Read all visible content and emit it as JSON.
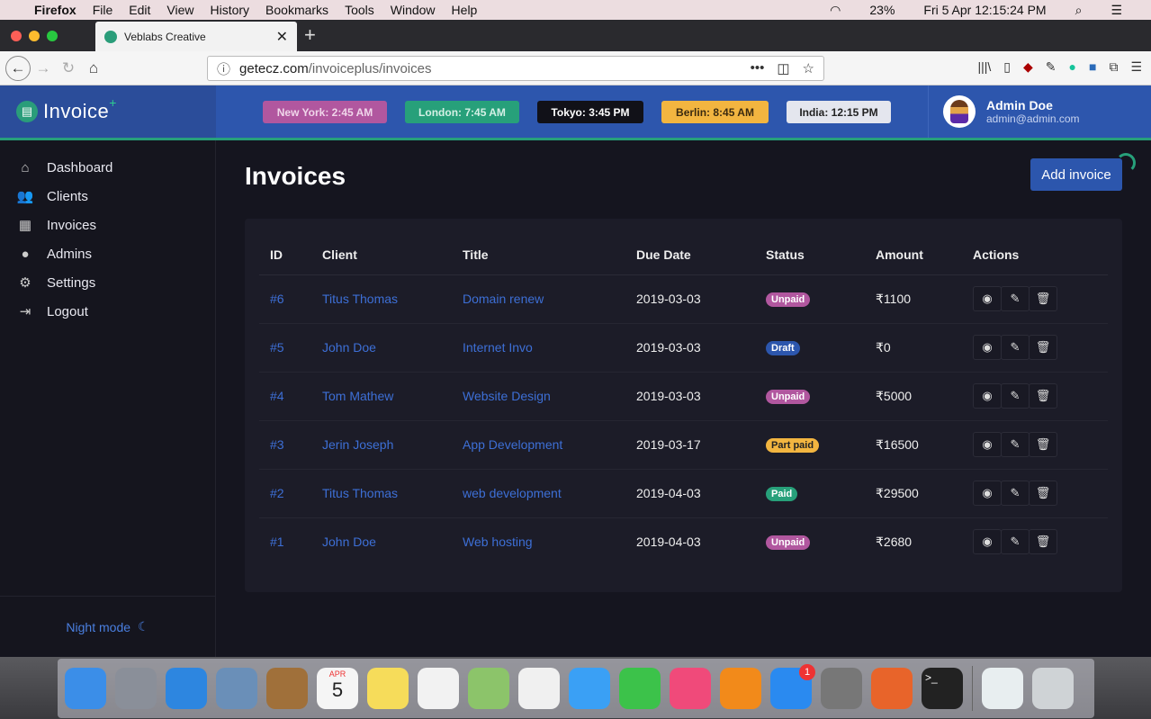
{
  "menubar": {
    "app": "Firefox",
    "items": [
      "File",
      "Edit",
      "View",
      "History",
      "Bookmarks",
      "Tools",
      "Window",
      "Help"
    ],
    "battery": "23%",
    "datetime": "Fri 5 Apr  12:15:24 PM"
  },
  "browser": {
    "tab_title": "Veblabs Creative",
    "url_host": "getecz.com",
    "url_path": "/invoiceplus/invoices"
  },
  "app": {
    "logo": "Invoice",
    "logo_plus": "+",
    "clocks": [
      {
        "label": "New York: 2:45 AM",
        "bg": "#b1579f",
        "fg": "#f0d6ea"
      },
      {
        "label": "London: 7:45 AM",
        "bg": "#27a07a",
        "fg": "#d5f0e6"
      },
      {
        "label": "Tokyo: 3:45 PM",
        "bg": "#111118",
        "fg": "#ffffff"
      },
      {
        "label": "Berlin: 8:45 AM",
        "bg": "#f2b540",
        "fg": "#3a2a10"
      },
      {
        "label": "India: 12:15 PM",
        "bg": "#e4e6ee",
        "fg": "#222"
      }
    ],
    "user": {
      "name": "Admin Doe",
      "email": "admin@admin.com"
    }
  },
  "sidebar": {
    "items": [
      {
        "label": "Dashboard",
        "icon": "⌂"
      },
      {
        "label": "Clients",
        "icon": "👥"
      },
      {
        "label": "Invoices",
        "icon": "▦"
      },
      {
        "label": "Admins",
        "icon": "●"
      },
      {
        "label": "Settings",
        "icon": "⚙"
      },
      {
        "label": "Logout",
        "icon": "⇥"
      }
    ],
    "night_mode": "Night mode",
    "night_icon": "☾"
  },
  "main": {
    "title": "Invoices",
    "add_button": "Add invoice",
    "columns": [
      "ID",
      "Client",
      "Title",
      "Due Date",
      "Status",
      "Amount",
      "Actions"
    ],
    "rows": [
      {
        "id": "#6",
        "client": "Titus Thomas",
        "title": "Domain renew",
        "due": "2019-03-03",
        "status": "Unpaid",
        "amount": "₹1100"
      },
      {
        "id": "#5",
        "client": "John Doe",
        "title": "Internet Invo",
        "due": "2019-03-03",
        "status": "Draft",
        "amount": "₹0"
      },
      {
        "id": "#4",
        "client": "Tom Mathew",
        "title": "Website Design",
        "due": "2019-03-03",
        "status": "Unpaid",
        "amount": "₹5000"
      },
      {
        "id": "#3",
        "client": "Jerin Joseph",
        "title": "App Development",
        "due": "2019-03-17",
        "status": "Part paid",
        "amount": "₹16500"
      },
      {
        "id": "#2",
        "client": "Titus Thomas",
        "title": "web development",
        "due": "2019-04-03",
        "status": "Paid",
        "amount": "₹29500"
      },
      {
        "id": "#1",
        "client": "John Doe",
        "title": "Web hosting",
        "due": "2019-04-03",
        "status": "Unpaid",
        "amount": "₹2680"
      }
    ],
    "status_colors": {
      "Unpaid": "#b1579f",
      "Draft": "#2c56ad",
      "Part paid": "#f2b540",
      "Paid": "#27a07a"
    }
  },
  "dock": {
    "calendar_month": "APR",
    "calendar_day": "5",
    "appstore_badge": "1",
    "apps": [
      {
        "name": "finder",
        "color": "#3b8ee8"
      },
      {
        "name": "launchpad",
        "color": "#8a8f99"
      },
      {
        "name": "safari",
        "color": "#2d86e0"
      },
      {
        "name": "preview",
        "color": "#6a8fb8"
      },
      {
        "name": "contacts",
        "color": "#a0703a"
      },
      {
        "name": "calendar",
        "color": "#f5f5f5"
      },
      {
        "name": "notes",
        "color": "#f6dc5a"
      },
      {
        "name": "reminders",
        "color": "#f2f2f2"
      },
      {
        "name": "maps",
        "color": "#8cc46a"
      },
      {
        "name": "photos",
        "color": "#f0f0f0"
      },
      {
        "name": "messages",
        "color": "#3aa0f5"
      },
      {
        "name": "facetime",
        "color": "#3cc24a"
      },
      {
        "name": "itunes",
        "color": "#f04a7a"
      },
      {
        "name": "books",
        "color": "#f28a1a"
      },
      {
        "name": "app-store",
        "color": "#2a8af0"
      },
      {
        "name": "system-preferences",
        "color": "#777"
      },
      {
        "name": "firefox",
        "color": "#e8642a"
      },
      {
        "name": "terminal",
        "color": "#222"
      }
    ]
  }
}
